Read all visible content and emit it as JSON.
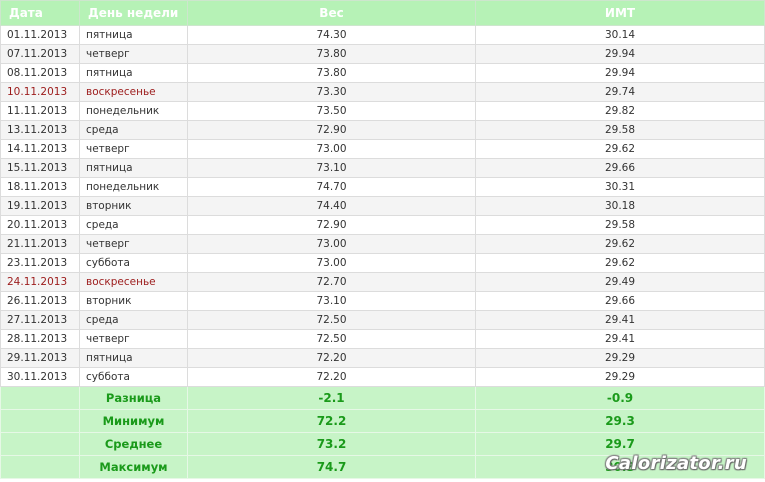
{
  "headers": {
    "date": "Дата",
    "day": "День недели",
    "weight": "Вес",
    "bmi": "ИМТ"
  },
  "rows": [
    {
      "date": "01.11.2013",
      "day": "пятница",
      "weight": "74.30",
      "bmi": "30.14"
    },
    {
      "date": "07.11.2013",
      "day": "четверг",
      "weight": "73.80",
      "bmi": "29.94"
    },
    {
      "date": "08.11.2013",
      "day": "пятница",
      "weight": "73.80",
      "bmi": "29.94"
    },
    {
      "date": "10.11.2013",
      "day": "воскресенье",
      "weight": "73.30",
      "bmi": "29.74"
    },
    {
      "date": "11.11.2013",
      "day": "понедельник",
      "weight": "73.50",
      "bmi": "29.82"
    },
    {
      "date": "13.11.2013",
      "day": "среда",
      "weight": "72.90",
      "bmi": "29.58"
    },
    {
      "date": "14.11.2013",
      "day": "четверг",
      "weight": "73.00",
      "bmi": "29.62"
    },
    {
      "date": "15.11.2013",
      "day": "пятница",
      "weight": "73.10",
      "bmi": "29.66"
    },
    {
      "date": "18.11.2013",
      "day": "понедельник",
      "weight": "74.70",
      "bmi": "30.31"
    },
    {
      "date": "19.11.2013",
      "day": "вторник",
      "weight": "74.40",
      "bmi": "30.18"
    },
    {
      "date": "20.11.2013",
      "day": "среда",
      "weight": "72.90",
      "bmi": "29.58"
    },
    {
      "date": "21.11.2013",
      "day": "четверг",
      "weight": "73.00",
      "bmi": "29.62"
    },
    {
      "date": "23.11.2013",
      "day": "суббота",
      "weight": "73.00",
      "bmi": "29.62"
    },
    {
      "date": "24.11.2013",
      "day": "воскресенье",
      "weight": "72.70",
      "bmi": "29.49"
    },
    {
      "date": "26.11.2013",
      "day": "вторник",
      "weight": "73.10",
      "bmi": "29.66"
    },
    {
      "date": "27.11.2013",
      "day": "среда",
      "weight": "72.50",
      "bmi": "29.41"
    },
    {
      "date": "28.11.2013",
      "day": "четверг",
      "weight": "72.50",
      "bmi": "29.41"
    },
    {
      "date": "29.11.2013",
      "day": "пятница",
      "weight": "72.20",
      "bmi": "29.29"
    },
    {
      "date": "30.11.2013",
      "day": "суббота",
      "weight": "72.20",
      "bmi": "29.29"
    }
  ],
  "stats": [
    {
      "label": "Разница",
      "weight": "-2.1",
      "bmi": "-0.9"
    },
    {
      "label": "Минимум",
      "weight": "72.2",
      "bmi": "29.3"
    },
    {
      "label": "Среднее",
      "weight": "73.2",
      "bmi": "29.7"
    },
    {
      "label": "Максимум",
      "weight": "74.7",
      "bmi": "30.3"
    }
  ],
  "watermark": "Calorizator.ru",
  "colors": {
    "header_bg": "#b6f2b6",
    "stat_bg": "#c7f4c7",
    "stat_text": "#1a9a1a",
    "weekend_text": "#9c1b1b"
  }
}
